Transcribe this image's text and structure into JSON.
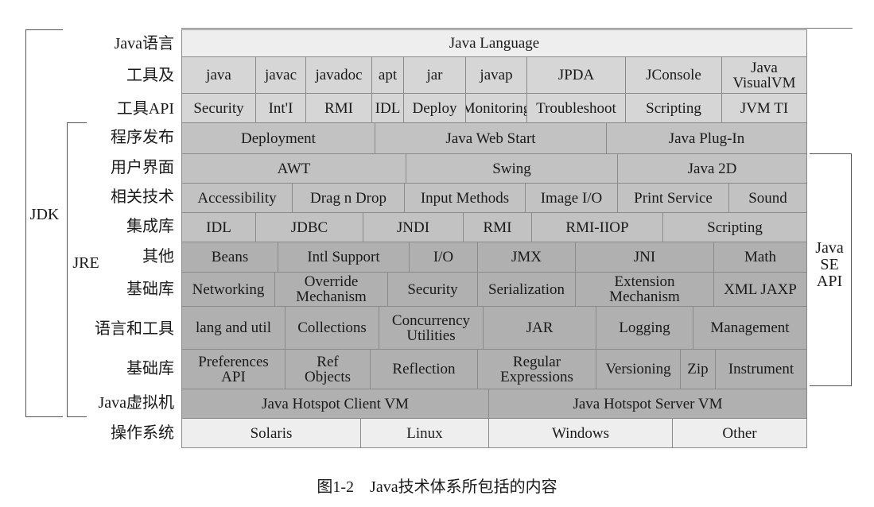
{
  "diagram": {
    "side_labels": {
      "jdk": "JDK",
      "jre": "JRE",
      "java_se_api": "Java\nSE\nAPI"
    },
    "row_labels": [
      "Java语言",
      "工具及",
      "工具API",
      "程序发布",
      "用户界面",
      "相关技术",
      "集成库",
      "其他",
      "基础库",
      "语言和工具",
      "基础库",
      "Java虚拟机",
      "操作系统"
    ],
    "rows": [
      [
        "Java Language"
      ],
      [
        "java",
        "javac",
        "javadoc",
        "apt",
        "jar",
        "javap",
        "JPDA",
        "JConsole",
        "Java\nVisualVM"
      ],
      [
        "Security",
        "Int'I",
        "RMI",
        "IDL",
        "Deploy",
        "Monitoring",
        "Troubleshoot",
        "Scripting",
        "JVM TI"
      ],
      [
        "Deployment",
        "Java Web Start",
        "Java Plug-In"
      ],
      [
        "AWT",
        "Swing",
        "Java 2D"
      ],
      [
        "Accessibility",
        "Drag n Drop",
        "Input Methods",
        "Image I/O",
        "Print Service",
        "Sound"
      ],
      [
        "IDL",
        "JDBC",
        "JNDI",
        "RMI",
        "RMI-IIOP",
        "Scripting"
      ],
      [
        "Beans",
        "Intl Support",
        "I/O",
        "JMX",
        "JNI",
        "Math"
      ],
      [
        "Networking",
        "Override\nMechanism",
        "Security",
        "Serialization",
        "Extension\nMechanism",
        "XML JAXP"
      ],
      [
        "lang and util",
        "Collections",
        "Concurrency\nUtilities",
        "JAR",
        "Logging",
        "Management"
      ],
      [
        "Preferences\nAPI",
        "Ref\nObjects",
        "Reflection",
        "Regular\nExpressions",
        "Versioning",
        "Zip",
        "Instrument"
      ],
      [
        "Java Hotspot Client VM",
        "Java Hotspot Server VM"
      ],
      [
        "Solaris",
        "Linux",
        "Windows",
        "Other"
      ]
    ],
    "caption": "图1-2　Java技术体系所包括的内容"
  }
}
